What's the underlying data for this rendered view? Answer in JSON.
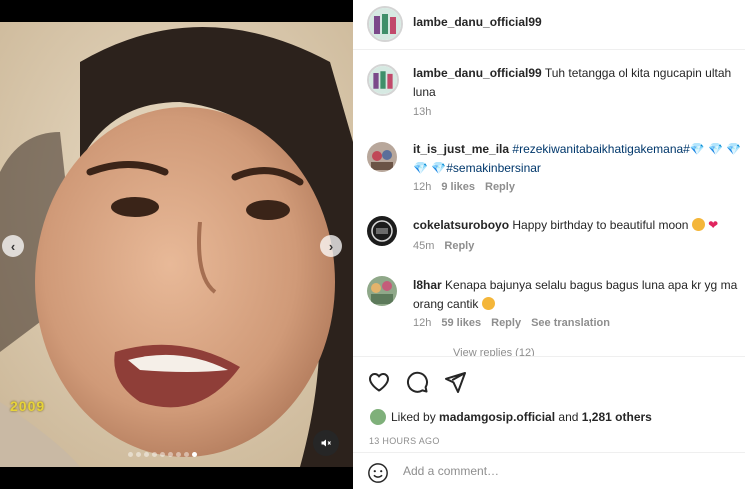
{
  "post": {
    "username": "lambe_danu_official99",
    "media": {
      "year_overlay": "2009",
      "slide_count": 9,
      "active_slide": 9
    },
    "caption": {
      "username": "lambe_danu_official99",
      "text": "Tuh tetangga ol kita ngucapin ultah",
      "text_line2": "luna",
      "time": "13h"
    },
    "comments": [
      {
        "username": "it_is_just_me_ila",
        "tag1": "#rezekiwanitabaikhatigakemana#",
        "gems1": "💎 💎 💎 ",
        "gems2": "💎 💎",
        "tag2": "#semakinbersinar",
        "time": "12h",
        "likes": "9 likes",
        "reply": "Reply"
      },
      {
        "username": "cokelatsuroboyo",
        "text": "Happy birthday to beautiful moon",
        "time": "45m",
        "reply": "Reply"
      },
      {
        "username": "l8har",
        "text": "Kenapa bajunya selalu bagus bagus luna apa kr yg ma",
        "text_line2": "orang cantik",
        "time": "12h",
        "likes": "59 likes",
        "reply": "Reply",
        "translate": "See translation"
      }
    ],
    "view_replies": "View replies (12)",
    "liked_by": {
      "prefix": "Liked by",
      "user": "madamgosip.official",
      "and": "and",
      "others": "1,281 others"
    },
    "timestamp": "13 HOURS AGO",
    "add_comment_placeholder": "Add a comment…"
  }
}
